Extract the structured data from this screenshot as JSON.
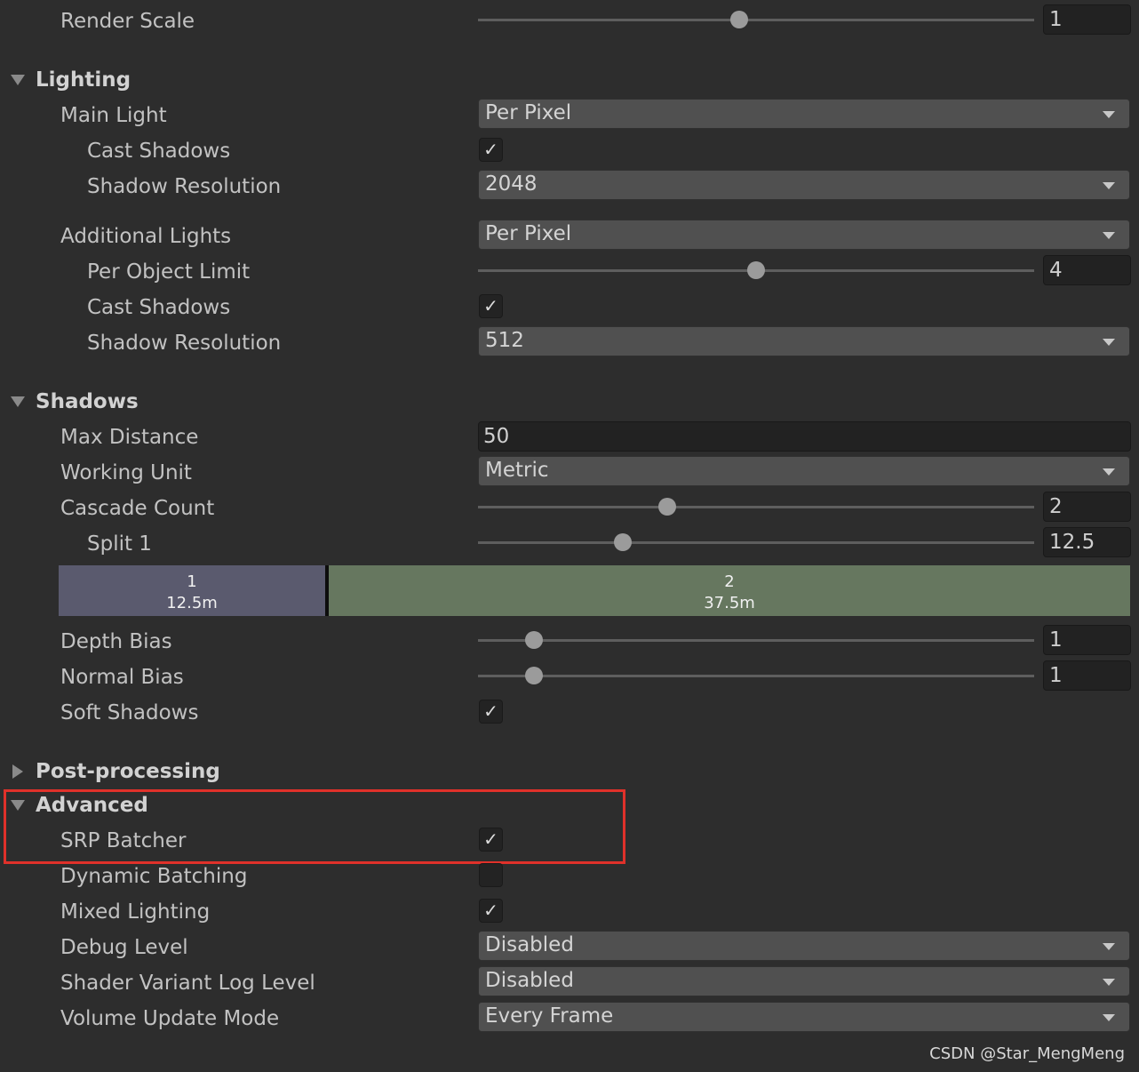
{
  "render_scale": {
    "label": "Render Scale",
    "value": "1",
    "level": 0.47
  },
  "lighting": {
    "header": "Lighting",
    "main_light": {
      "label": "Main Light",
      "value": "Per Pixel"
    },
    "main_cast_shadows": {
      "label": "Cast Shadows",
      "checked": true
    },
    "main_shadow_resolution": {
      "label": "Shadow Resolution",
      "value": "2048"
    },
    "additional_lights": {
      "label": "Additional Lights",
      "value": "Per Pixel"
    },
    "per_object_limit": {
      "label": "Per Object Limit",
      "value": "4",
      "level": 0.5
    },
    "additional_cast_shadows": {
      "label": "Cast Shadows",
      "checked": true
    },
    "additional_shadow_resolution": {
      "label": "Shadow Resolution",
      "value": "512"
    }
  },
  "shadows": {
    "header": "Shadows",
    "max_distance": {
      "label": "Max Distance",
      "value": "50"
    },
    "working_unit": {
      "label": "Working Unit",
      "value": "Metric"
    },
    "cascade_count": {
      "label": "Cascade Count",
      "value": "2",
      "level": 0.34
    },
    "split_1": {
      "label": "Split 1",
      "value": "12.5",
      "level": 0.26
    },
    "cascades": [
      {
        "index": "1",
        "distance": "12.5m",
        "color": "#5a5a6e",
        "fraction": 0.25
      },
      {
        "index": "2",
        "distance": "37.5m",
        "color": "#66775f",
        "fraction": 0.75
      }
    ],
    "depth_bias": {
      "label": "Depth Bias",
      "value": "1",
      "level": 0.1
    },
    "normal_bias": {
      "label": "Normal Bias",
      "value": "1",
      "level": 0.1
    },
    "soft_shadows": {
      "label": "Soft Shadows",
      "checked": true
    }
  },
  "post_processing": {
    "header": "Post-processing"
  },
  "advanced": {
    "header": "Advanced",
    "srp_batcher": {
      "label": "SRP Batcher",
      "checked": true
    },
    "dynamic_batching": {
      "label": "Dynamic Batching",
      "checked": false
    },
    "mixed_lighting": {
      "label": "Mixed Lighting",
      "checked": true
    },
    "debug_level": {
      "label": "Debug Level",
      "value": "Disabled"
    },
    "shader_variant_log_level": {
      "label": "Shader Variant Log Level",
      "value": "Disabled"
    },
    "volume_update_mode": {
      "label": "Volume Update Mode",
      "value": "Every Frame"
    }
  },
  "checkmark_glyph": "✓",
  "highlight_color": "#e0312a",
  "watermark": "CSDN @Star_MengMeng"
}
